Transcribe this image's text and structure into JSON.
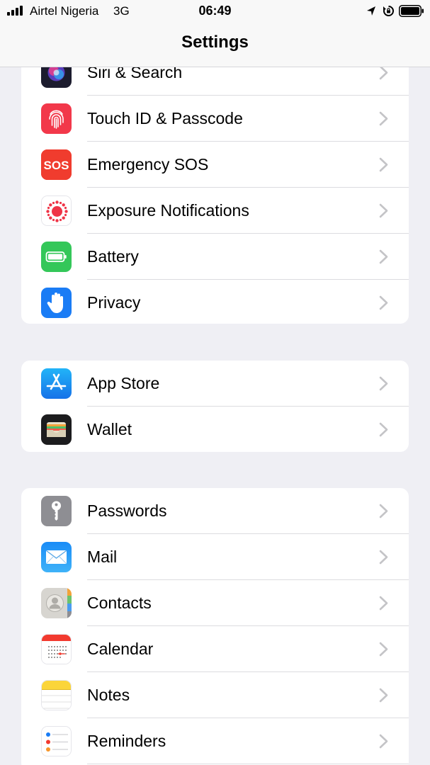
{
  "status_bar": {
    "carrier": "Airtel Nigeria",
    "network": "3G",
    "time": "06:49"
  },
  "nav": {
    "title": "Settings"
  },
  "groups": [
    {
      "items": [
        {
          "label": "Siri & Search",
          "icon": "siri-icon"
        },
        {
          "label": "Touch ID & Passcode",
          "icon": "fingerprint-icon"
        },
        {
          "label": "Emergency SOS",
          "icon": "sos-icon",
          "icon_text": "SOS"
        },
        {
          "label": "Exposure Notifications",
          "icon": "exposure-icon"
        },
        {
          "label": "Battery",
          "icon": "battery-setting-icon"
        },
        {
          "label": "Privacy",
          "icon": "hand-icon"
        }
      ]
    },
    {
      "items": [
        {
          "label": "App Store",
          "icon": "app-store-icon"
        },
        {
          "label": "Wallet",
          "icon": "wallet-icon"
        }
      ]
    },
    {
      "items": [
        {
          "label": "Passwords",
          "icon": "key-icon"
        },
        {
          "label": "Mail",
          "icon": "mail-icon"
        },
        {
          "label": "Contacts",
          "icon": "contacts-icon"
        },
        {
          "label": "Calendar",
          "icon": "calendar-icon"
        },
        {
          "label": "Notes",
          "icon": "notes-icon"
        },
        {
          "label": "Reminders",
          "icon": "reminders-icon"
        }
      ]
    }
  ],
  "colors": {
    "background": "#efeff4",
    "touch_id": "#f2384a",
    "sos": "#f03c2e",
    "battery_green": "#34c759",
    "privacy_blue": "#1a7cf5",
    "app_store_blue": "#1a8cf0",
    "mail_blue": "#2e9bf5",
    "passwords_gray": "#8e8e93"
  }
}
